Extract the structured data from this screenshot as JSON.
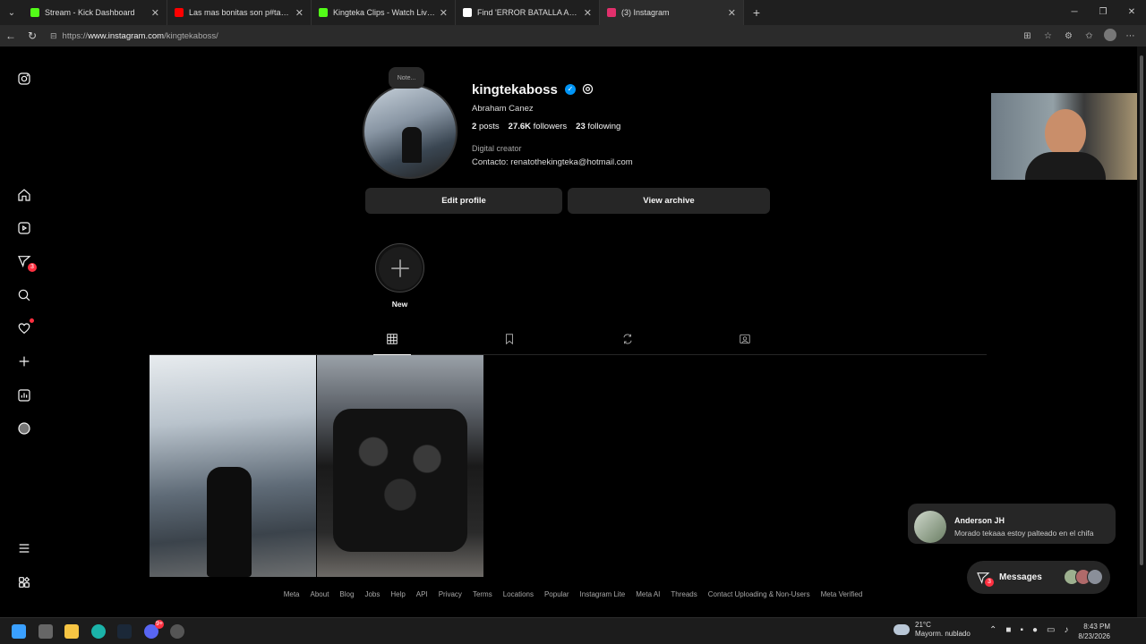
{
  "browser": {
    "tabs": [
      {
        "title": "Stream - Kick Dashboard",
        "favicon_color": "#53fc18",
        "active": false
      },
      {
        "title": "Las mas bonitas son p#tas - YouTube",
        "favicon_color": "#ff0000",
        "active": false
      },
      {
        "title": "Kingteka Clips - Watch Live on Kick",
        "favicon_color": "#53fc18",
        "active": false
      },
      {
        "title": "Find 'ERROR BATALLA AURA' on TikTok",
        "favicon_color": "#ffffff",
        "active": false
      },
      {
        "title": "(3) Instagram",
        "favicon_color": "#e1306c",
        "active": true
      }
    ],
    "url_prefix": "https://",
    "url_host": "www.instagram.com",
    "url_path": "/kingtekaboss/"
  },
  "sidebar": {
    "messages_badge": "3"
  },
  "profile": {
    "note": "Note...",
    "username": "kingtekaboss",
    "full_name": "Abraham Canez",
    "posts_count": "2",
    "posts_label": "posts",
    "followers_count": "27.6K",
    "followers_label": "followers",
    "following_count": "23",
    "following_label": "following",
    "category": "Digital creator",
    "contact": "Contacto: renatothekingteka@hotmail.com",
    "edit_button": "Edit profile",
    "archive_button": "View archive",
    "new_highlight": "New"
  },
  "footer": {
    "links": [
      "Meta",
      "About",
      "Blog",
      "Jobs",
      "Help",
      "API",
      "Privacy",
      "Terms",
      "Locations",
      "Popular",
      "Instagram Lite",
      "Meta AI",
      "Threads",
      "Contact Uploading & Non-Users",
      "Meta Verified"
    ]
  },
  "notification": {
    "name": "Anderson JH",
    "message": "Morado tekaaa estoy palteado en el chifa"
  },
  "messages": {
    "label": "Messages",
    "badge": "3"
  },
  "taskbar": {
    "temperature": "21°C",
    "weather": "Mayorm. nublado",
    "time": "8:43 PM",
    "date": "8/23/2026",
    "discord_badge": "9+"
  }
}
